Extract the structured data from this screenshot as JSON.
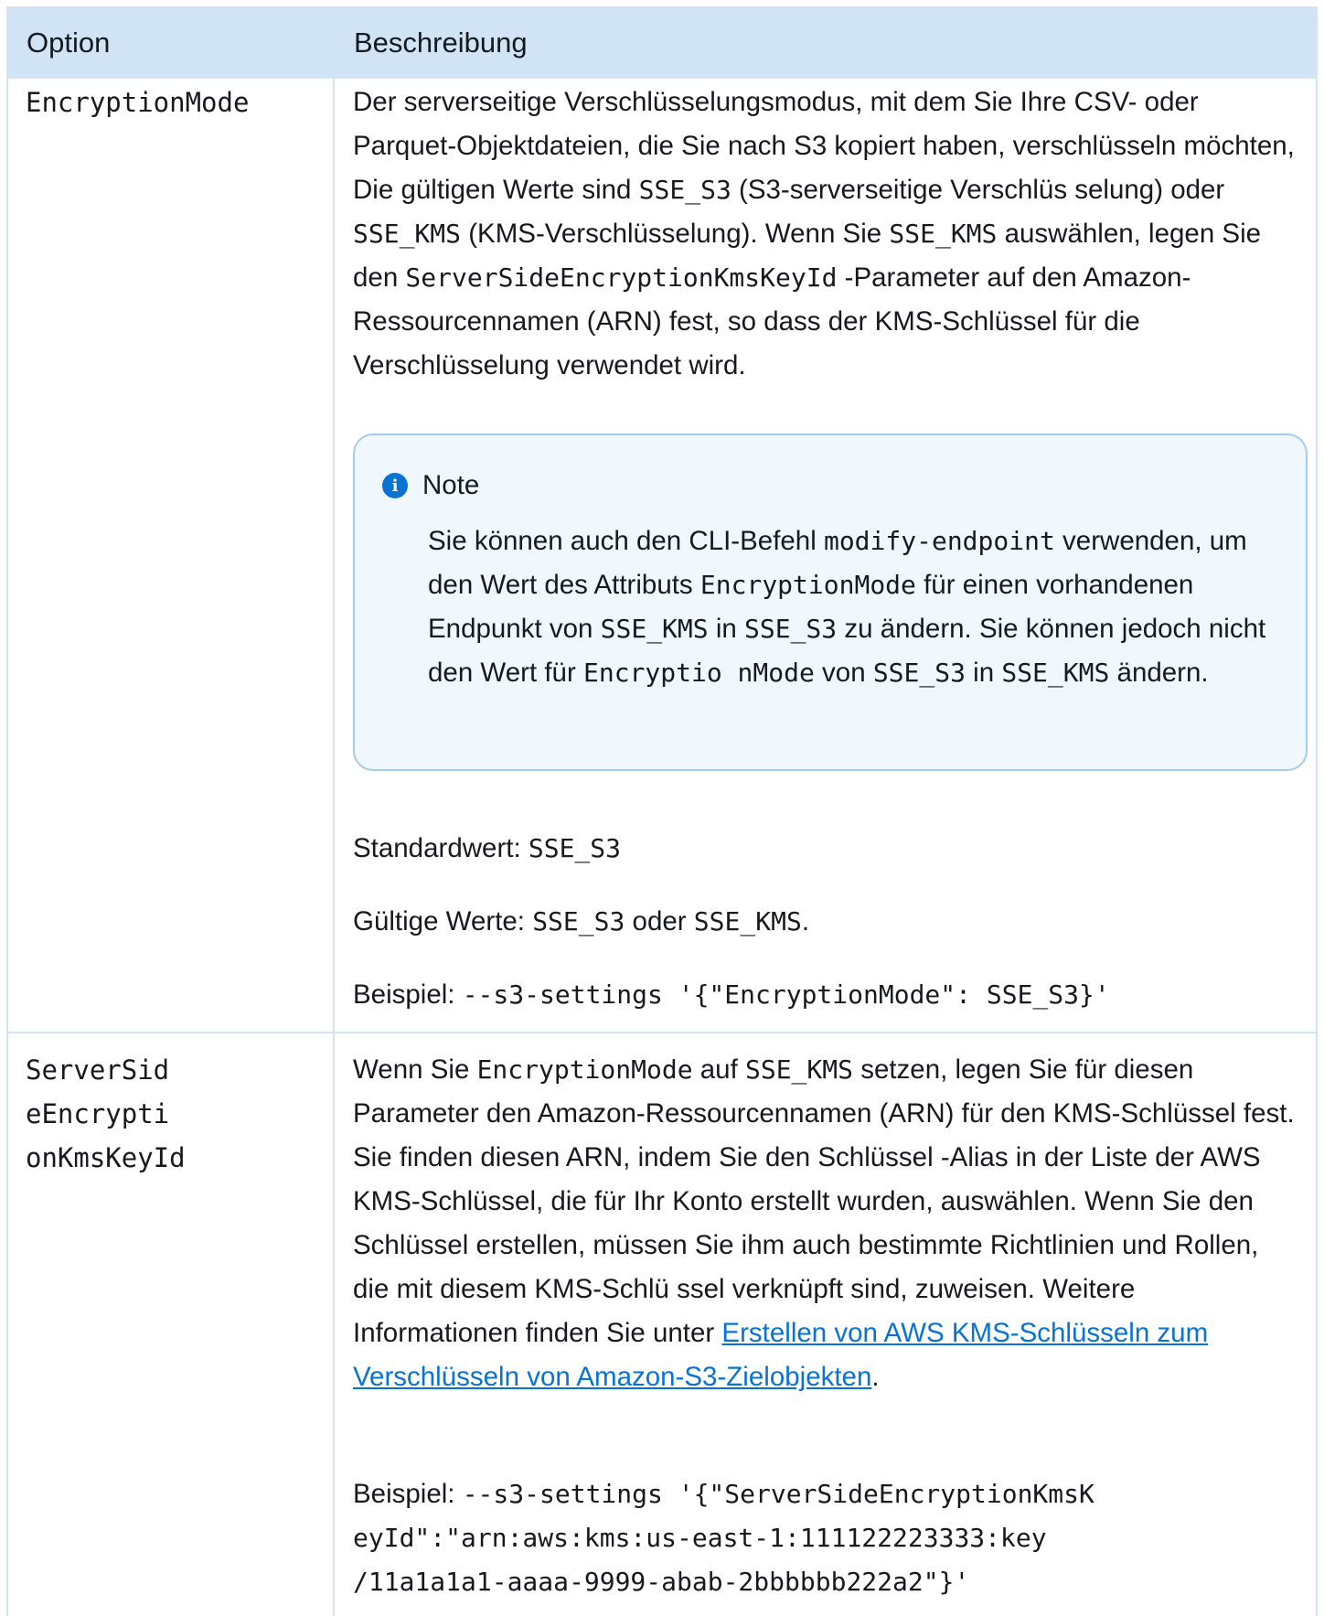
{
  "table": {
    "header": {
      "option": "Option",
      "description": "Beschreibung"
    },
    "rows": [
      {
        "option": "EncryptionMode",
        "desc": {
          "t1": "Der serverseitige Verschlüsselungsmodus, mit dem Sie Ihre CSV- oder Parquet-Objektdateien, die Sie nach S3 kopiert haben, verschlüsseln möchten, Die gültigen Werte sind ",
          "c1": "SSE_S3",
          "t2": " (S3-serverseitige Verschlüs selung) oder ",
          "c2": "SSE_KMS",
          "t3": " (KMS-Verschlüsselung). Wenn Sie ",
          "c3": "SSE_KMS",
          "t4": " auswählen, legen Sie den ",
          "c4": "ServerSideEncryptionKmsKeyId",
          "t5": "     -Parameter auf den Amazon-Ressourcennamen (ARN) fest, so dass der KMS-Schlüssel für die Verschlüsselung verwendet wird."
        },
        "note": {
          "title": "Note",
          "t1": "Sie können auch den CLI-Befehl ",
          "c1": "modify-endpoint",
          "t2": " verwenden, um den Wert des Attributs ",
          "c2": "EncryptionMode",
          "t3": " für einen vorhandenen Endpunkt von ",
          "c3": "SSE_KMS",
          "t4": " in ",
          "c4": "SSE_S3",
          "t5": " zu ändern. Sie können jedoch nicht den Wert für ",
          "c5": "Encryptio nMode",
          "t6": "   von ",
          "c6": "SSE_S3",
          "t7": " in ",
          "c7": "SSE_KMS",
          "t8": " ändern."
        },
        "default": {
          "label": "Standardwert: ",
          "value": "SSE_S3"
        },
        "valid": {
          "label": "Gültige Werte: ",
          "v1": "SSE_S3",
          "mid": " oder ",
          "v2": "SSE_KMS",
          "end": "."
        },
        "example": {
          "label": "Beispiel: ",
          "code": "--s3-settings '{\"EncryptionMode\": SSE_S3}'"
        }
      },
      {
        "option_lines": [
          "ServerSid",
          "eEncrypti",
          "onKmsKeyId"
        ],
        "desc": {
          "t1": "Wenn Sie ",
          "c1": "EncryptionMode",
          "t2": "   auf ",
          "c2": "SSE_KMS",
          "t3": " setzen, legen Sie für diesen Parameter den Amazon-Ressourcennamen (ARN) für den KMS-Schlüssel fest. Sie finden diesen ARN, indem Sie den Schlüssel -Alias in der Liste der AWS KMS-Schlüssel, die für Ihr Konto erstellt wurden, auswählen. Wenn Sie den Schlüssel erstellen, müssen Sie ihm auch bestimmte Richtlinien und Rollen, die mit diesem KMS-Schlü ssel verknüpft sind, zuweisen. Weitere Informationen finden Sie unter ",
          "link": "Erstellen von AWS KMS-Schlüsseln zum Verschlüsseln von Amazon-S3-Zielobjekten",
          "t4": "."
        },
        "example": {
          "label": "Beispiel: ",
          "code_lines": [
            "--s3-settings '{\"ServerSideEncryptionKmsK",
            "eyId\":\"arn:aws:kms:us-east-1:111122223333:key",
            "/11a1a1a1-aaaa-9999-abab-2bbbbbb222a2\"}'"
          ]
        }
      }
    ]
  },
  "icons": {
    "note": "info-icon"
  }
}
